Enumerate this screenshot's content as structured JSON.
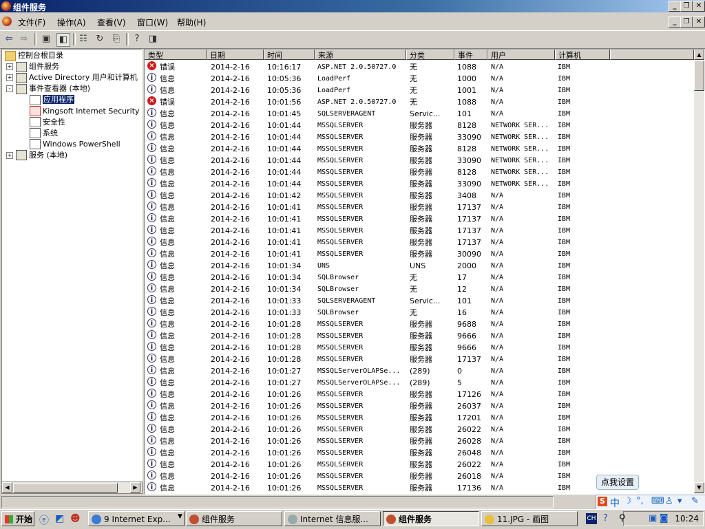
{
  "window": {
    "title": "组件服务"
  },
  "menu": [
    "文件(F)",
    "操作(A)",
    "查看(V)",
    "窗口(W)",
    "帮助(H)"
  ],
  "tree": [
    {
      "label": "控制台根目录",
      "indent": 0,
      "expander": "",
      "icon": "folder"
    },
    {
      "label": "组件服务",
      "indent": 1,
      "expander": "+",
      "icon": "component"
    },
    {
      "label": "Active Directory 用户和计算机",
      "indent": 1,
      "expander": "+",
      "icon": "ad"
    },
    {
      "label": "事件查看器 (本地)",
      "indent": 1,
      "expander": "-",
      "icon": "eventviewer"
    },
    {
      "label": "应用程序",
      "indent": 2,
      "expander": "",
      "icon": "log",
      "selected": true
    },
    {
      "label": "Kingsoft Internet Security",
      "indent": 2,
      "expander": "",
      "icon": "kis"
    },
    {
      "label": "安全性",
      "indent": 2,
      "expander": "",
      "icon": "log"
    },
    {
      "label": "系统",
      "indent": 2,
      "expander": "",
      "icon": "log"
    },
    {
      "label": "Windows PowerShell",
      "indent": 2,
      "expander": "",
      "icon": "log"
    },
    {
      "label": "服务 (本地)",
      "indent": 1,
      "expander": "+",
      "icon": "services"
    }
  ],
  "columns": [
    "类型",
    "日期",
    "时间",
    "来源",
    "分类",
    "事件",
    "用户",
    "计算机"
  ],
  "rows": [
    [
      "错误",
      "2014-2-16",
      "10:16:17",
      "ASP.NET 2.0.50727.0",
      "无",
      "1088",
      "N/A",
      "IBM"
    ],
    [
      "信息",
      "2014-2-16",
      "10:05:36",
      "LoadPerf",
      "无",
      "1000",
      "N/A",
      "IBM"
    ],
    [
      "信息",
      "2014-2-16",
      "10:05:36",
      "LoadPerf",
      "无",
      "1001",
      "N/A",
      "IBM"
    ],
    [
      "错误",
      "2014-2-16",
      "10:01:56",
      "ASP.NET 2.0.50727.0",
      "无",
      "1088",
      "N/A",
      "IBM"
    ],
    [
      "信息",
      "2014-2-16",
      "10:01:45",
      "SQLSERVERAGENT",
      "Servic...",
      "101",
      "N/A",
      "IBM"
    ],
    [
      "信息",
      "2014-2-16",
      "10:01:44",
      "MSSQLSERVER",
      "服务器",
      "8128",
      "NETWORK SER...",
      "IBM"
    ],
    [
      "信息",
      "2014-2-16",
      "10:01:44",
      "MSSQLSERVER",
      "服务器",
      "33090",
      "NETWORK SER...",
      "IBM"
    ],
    [
      "信息",
      "2014-2-16",
      "10:01:44",
      "MSSQLSERVER",
      "服务器",
      "8128",
      "NETWORK SER...",
      "IBM"
    ],
    [
      "信息",
      "2014-2-16",
      "10:01:44",
      "MSSQLSERVER",
      "服务器",
      "33090",
      "NETWORK SER...",
      "IBM"
    ],
    [
      "信息",
      "2014-2-16",
      "10:01:44",
      "MSSQLSERVER",
      "服务器",
      "8128",
      "NETWORK SER...",
      "IBM"
    ],
    [
      "信息",
      "2014-2-16",
      "10:01:44",
      "MSSQLSERVER",
      "服务器",
      "33090",
      "NETWORK SER...",
      "IBM"
    ],
    [
      "信息",
      "2014-2-16",
      "10:01:42",
      "MSSQLSERVER",
      "服务器",
      "3408",
      "N/A",
      "IBM"
    ],
    [
      "信息",
      "2014-2-16",
      "10:01:41",
      "MSSQLSERVER",
      "服务器",
      "17137",
      "N/A",
      "IBM"
    ],
    [
      "信息",
      "2014-2-16",
      "10:01:41",
      "MSSQLSERVER",
      "服务器",
      "17137",
      "N/A",
      "IBM"
    ],
    [
      "信息",
      "2014-2-16",
      "10:01:41",
      "MSSQLSERVER",
      "服务器",
      "17137",
      "N/A",
      "IBM"
    ],
    [
      "信息",
      "2014-2-16",
      "10:01:41",
      "MSSQLSERVER",
      "服务器",
      "17137",
      "N/A",
      "IBM"
    ],
    [
      "信息",
      "2014-2-16",
      "10:01:41",
      "MSSQLSERVER",
      "服务器",
      "30090",
      "N/A",
      "IBM"
    ],
    [
      "信息",
      "2014-2-16",
      "10:01:34",
      "UNS",
      "UNS",
      "2000",
      "N/A",
      "IBM"
    ],
    [
      "信息",
      "2014-2-16",
      "10:01:34",
      "SQLBrowser",
      "无",
      "17",
      "N/A",
      "IBM"
    ],
    [
      "信息",
      "2014-2-16",
      "10:01:34",
      "SQLBrowser",
      "无",
      "12",
      "N/A",
      "IBM"
    ],
    [
      "信息",
      "2014-2-16",
      "10:01:33",
      "SQLSERVERAGENT",
      "Servic...",
      "101",
      "N/A",
      "IBM"
    ],
    [
      "信息",
      "2014-2-16",
      "10:01:33",
      "SQLBrowser",
      "无",
      "16",
      "N/A",
      "IBM"
    ],
    [
      "信息",
      "2014-2-16",
      "10:01:28",
      "MSSQLSERVER",
      "服务器",
      "9688",
      "N/A",
      "IBM"
    ],
    [
      "信息",
      "2014-2-16",
      "10:01:28",
      "MSSQLSERVER",
      "服务器",
      "9666",
      "N/A",
      "IBM"
    ],
    [
      "信息",
      "2014-2-16",
      "10:01:28",
      "MSSQLSERVER",
      "服务器",
      "9666",
      "N/A",
      "IBM"
    ],
    [
      "信息",
      "2014-2-16",
      "10:01:28",
      "MSSQLSERVER",
      "服务器",
      "17137",
      "N/A",
      "IBM"
    ],
    [
      "信息",
      "2014-2-16",
      "10:01:27",
      "MSSQLServerOLAPSe...",
      "(289)",
      "0",
      "N/A",
      "IBM"
    ],
    [
      "信息",
      "2014-2-16",
      "10:01:27",
      "MSSQLServerOLAPSe...",
      "(289)",
      "5",
      "N/A",
      "IBM"
    ],
    [
      "信息",
      "2014-2-16",
      "10:01:26",
      "MSSQLSERVER",
      "服务器",
      "17126",
      "N/A",
      "IBM"
    ],
    [
      "信息",
      "2014-2-16",
      "10:01:26",
      "MSSQLSERVER",
      "服务器",
      "26037",
      "N/A",
      "IBM"
    ],
    [
      "信息",
      "2014-2-16",
      "10:01:26",
      "MSSQLSERVER",
      "服务器",
      "17201",
      "N/A",
      "IBM"
    ],
    [
      "信息",
      "2014-2-16",
      "10:01:26",
      "MSSQLSERVER",
      "服务器",
      "26022",
      "N/A",
      "IBM"
    ],
    [
      "信息",
      "2014-2-16",
      "10:01:26",
      "MSSQLSERVER",
      "服务器",
      "26028",
      "N/A",
      "IBM"
    ],
    [
      "信息",
      "2014-2-16",
      "10:01:26",
      "MSSQLSERVER",
      "服务器",
      "26048",
      "N/A",
      "IBM"
    ],
    [
      "信息",
      "2014-2-16",
      "10:01:26",
      "MSSQLSERVER",
      "服务器",
      "26022",
      "N/A",
      "IBM"
    ],
    [
      "信息",
      "2014-2-16",
      "10:01:26",
      "MSSQLSERVER",
      "服务器",
      "26018",
      "N/A",
      "IBM"
    ],
    [
      "信息",
      "2014-2-16",
      "10:01:26",
      "MSSQLSERVER",
      "服务器",
      "17136",
      "N/A",
      "IBM"
    ]
  ],
  "ime": {
    "popup": "点我设置",
    "lang": "中"
  },
  "taskbar": {
    "start": "开始",
    "tasks": [
      {
        "label": "9 Internet Exp...",
        "icon": "ie-icon",
        "active": false
      },
      {
        "label": "组件服务",
        "icon": "component-services-icon",
        "active": false
      },
      {
        "label": "Internet 信息服...",
        "icon": "iis-icon",
        "active": false
      },
      {
        "label": "组件服务",
        "icon": "component-services-icon",
        "active": true
      },
      {
        "label": "11.JPG - 画图",
        "icon": "paint-icon",
        "active": false
      }
    ],
    "lang": "CH",
    "clock": "10:24"
  }
}
